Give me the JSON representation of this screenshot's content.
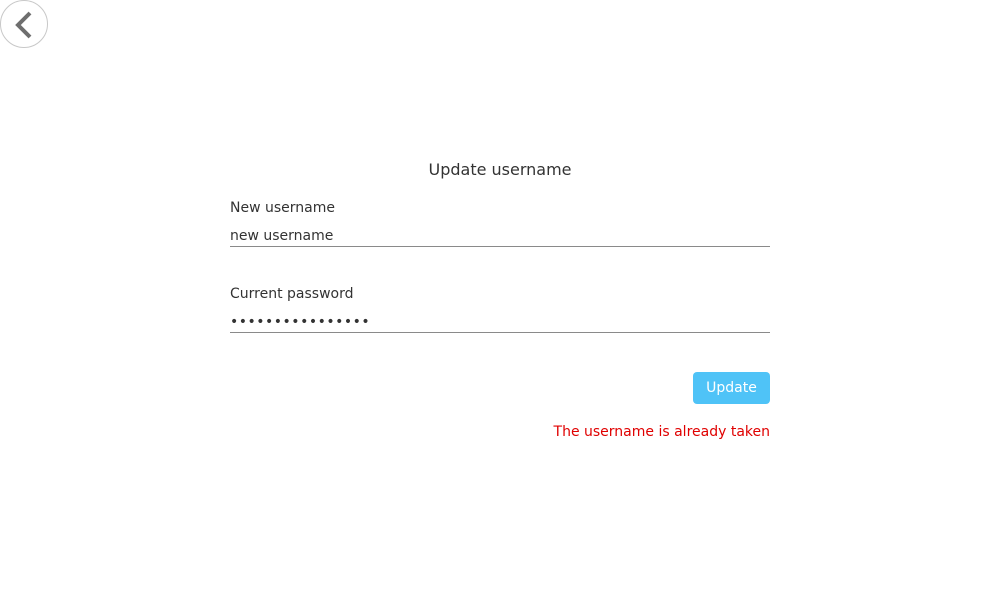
{
  "nav": {
    "back_icon": "chevron-left-icon"
  },
  "form": {
    "title": "Update username",
    "username": {
      "label": "New username",
      "value": "new username"
    },
    "password": {
      "label": "Current password",
      "value": "••••••••••••••••"
    },
    "submit_label": "Update",
    "error": "The username is already taken"
  },
  "colors": {
    "button_bg": "#4fc3f7",
    "error_text": "#e00000"
  }
}
